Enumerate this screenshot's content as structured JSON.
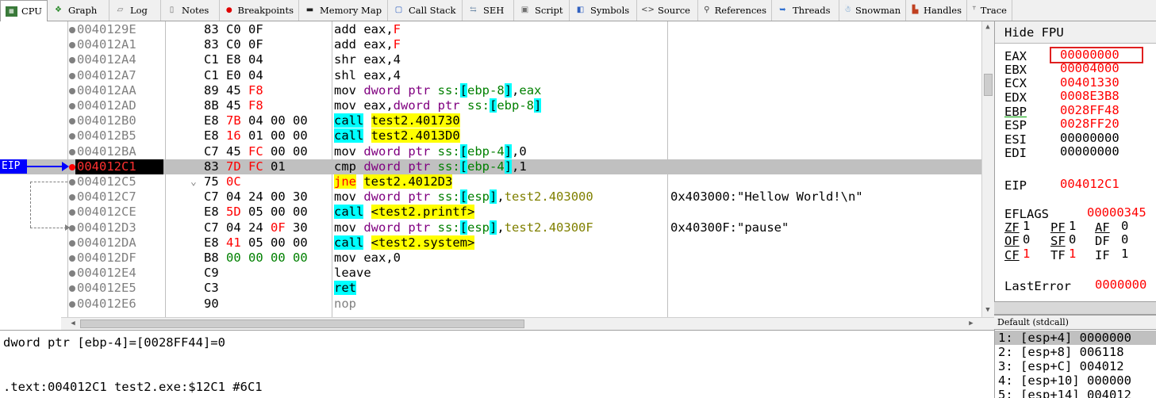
{
  "tabs": [
    {
      "label": "CPU",
      "icon": "cpu-icon",
      "active": true
    },
    {
      "label": "Graph",
      "icon": "graph-icon"
    },
    {
      "label": "Log",
      "icon": "log-icon"
    },
    {
      "label": "Notes",
      "icon": "notes-icon"
    },
    {
      "label": "Breakpoints",
      "icon": "breakpoint-icon"
    },
    {
      "label": "Memory Map",
      "icon": "memory-map-icon"
    },
    {
      "label": "Call Stack",
      "icon": "call-stack-icon"
    },
    {
      "label": "SEH",
      "icon": "seh-icon"
    },
    {
      "label": "Script",
      "icon": "script-icon"
    },
    {
      "label": "Symbols",
      "icon": "symbols-icon"
    },
    {
      "label": "Source",
      "icon": "source-icon"
    },
    {
      "label": "References",
      "icon": "references-icon"
    },
    {
      "label": "Threads",
      "icon": "threads-icon"
    },
    {
      "label": "Snowman",
      "icon": "snowman-icon"
    },
    {
      "label": "Handles",
      "icon": "handles-icon"
    },
    {
      "label": "Trace",
      "icon": "trace-icon"
    }
  ],
  "disasm": {
    "eip_label": "EIP",
    "rows": [
      {
        "addr": "0040129E",
        "bytes": "83 C0 0F",
        "instr": "add eax,F"
      },
      {
        "addr": "004012A1",
        "bytes": "83 C0 0F",
        "instr": "add eax,F"
      },
      {
        "addr": "004012A4",
        "bytes": "C1 E8 04",
        "instr": "shr eax,4"
      },
      {
        "addr": "004012A7",
        "bytes": "C1 E0 04",
        "instr": "shl eax,4"
      },
      {
        "addr": "004012AA",
        "bytes": "89 45 F8",
        "instr": "mov dword ptr ss:[ebp-8],eax"
      },
      {
        "addr": "004012AD",
        "bytes": "8B 45 F8",
        "instr": "mov eax,dword ptr ss:[ebp-8]"
      },
      {
        "addr": "004012B0",
        "bytes": "E8 7B 04 00 00",
        "instr": "call test2.401730"
      },
      {
        "addr": "004012B5",
        "bytes": "E8 16 01 00 00",
        "instr": "call test2.4013D0"
      },
      {
        "addr": "004012BA",
        "bytes": "C7 45 FC 00 00",
        "instr": "mov dword ptr ss:[ebp-4],0"
      },
      {
        "addr": "004012C1",
        "bytes": "83 7D FC 01",
        "instr": "cmp dword ptr ss:[ebp-4],1"
      },
      {
        "addr": "004012C5",
        "bytes": "75 0C",
        "instr": "jne test2.4012D3"
      },
      {
        "addr": "004012C7",
        "bytes": "C7 04 24 00 30",
        "instr": "mov dword ptr ss:[esp],test2.403000",
        "comment": "0x403000:\"Hellow World!\\n\""
      },
      {
        "addr": "004012CE",
        "bytes": "E8 5D 05 00 00",
        "instr": "call <test2.printf>"
      },
      {
        "addr": "004012D3",
        "bytes": "C7 04 24 0F 30",
        "instr": "mov dword ptr ss:[esp],test2.40300F",
        "comment": "0x40300F:\"pause\""
      },
      {
        "addr": "004012DA",
        "bytes": "E8 41 05 00 00",
        "instr": "call <test2.system>"
      },
      {
        "addr": "004012DF",
        "bytes": "B8 00 00 00 00",
        "instr": "mov eax,0"
      },
      {
        "addr": "004012E4",
        "bytes": "C9",
        "instr": "leave"
      },
      {
        "addr": "004012E5",
        "bytes": "C3",
        "instr": "ret"
      },
      {
        "addr": "004012E6",
        "bytes": "90",
        "instr": "nop"
      }
    ]
  },
  "info": {
    "line1": "dword ptr [ebp-4]=[0028FF44]=0",
    "line2": ".text:004012C1 test2.exe:$12C1 #6C1"
  },
  "registers": {
    "hide_fpu_label": "Hide FPU",
    "gpr": [
      {
        "name": "EAX",
        "value": "00000000"
      },
      {
        "name": "EBX",
        "value": "00004000"
      },
      {
        "name": "ECX",
        "value": "00401330"
      },
      {
        "name": "EDX",
        "value": "0008E3B8"
      },
      {
        "name": "EBP",
        "value": "0028FF48"
      },
      {
        "name": "ESP",
        "value": "0028FF20"
      },
      {
        "name": "ESI",
        "value": "00000000"
      },
      {
        "name": "EDI",
        "value": "00000000"
      }
    ],
    "eip": {
      "name": "EIP",
      "value": "004012C1"
    },
    "eflags": {
      "name": "EFLAGS",
      "value": "00000345"
    },
    "flags_row1": {
      "zf": "ZF",
      "zf_v": "1",
      "pf": "PF",
      "pf_v": "1",
      "af": "AF",
      "af_v": "0"
    },
    "flags_row2": {
      "of": "OF",
      "of_v": "0",
      "sf": "SF",
      "sf_v": "0",
      "df": "DF",
      "df_v": "0"
    },
    "flags_row3": {
      "cf": "CF",
      "cf_v": "1",
      "tf": "TF",
      "tf_v": "1",
      "if": "IF",
      "if_v": "1"
    },
    "lasterror": {
      "name": "LastError",
      "value": "0000000"
    }
  },
  "stack": {
    "header": "Default (stdcall)",
    "rows": [
      "1: [esp+4] 0000000",
      "2: [esp+8] 006118",
      "3: [esp+C] 004012",
      "4: [esp+10] 000000",
      "5: [esp+14] 004012"
    ]
  },
  "colors": {
    "eip_marker": "#0000ff",
    "breakpoint": "#ff0000",
    "selection": "#c0c0c0",
    "call_highlight": "#00ffff",
    "label_highlight": "#ffff00"
  }
}
